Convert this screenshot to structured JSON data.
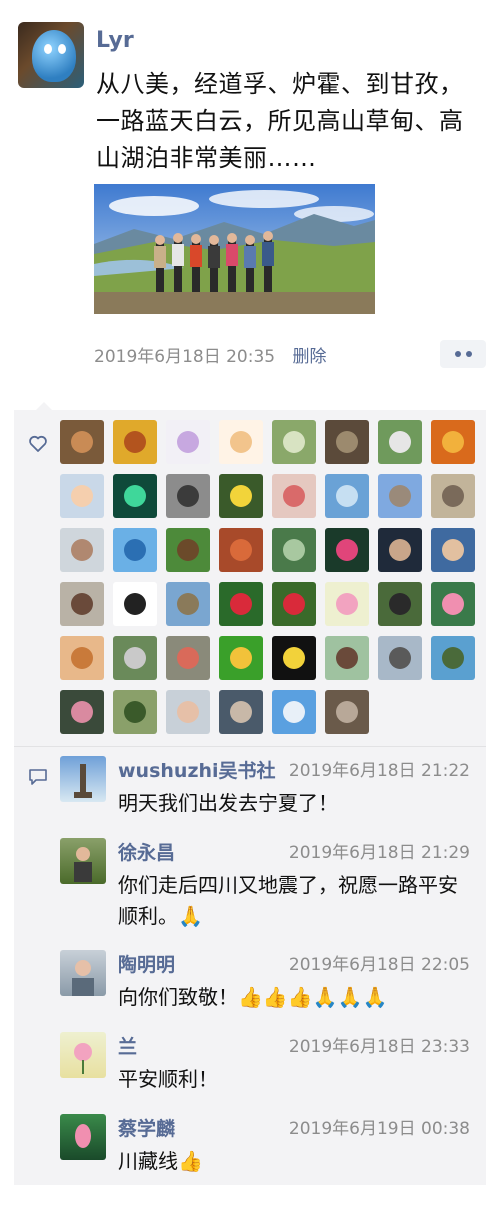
{
  "post": {
    "author": "Lyr",
    "text": "从八美，经道孚、炉霍、到甘孜，一路蓝天白云，所见高山草甸、高山湖泊非常美丽……",
    "timestamp": "2019年6月18日 20:35",
    "delete_label": "删除"
  },
  "likes": {
    "tiles": [
      {
        "bg": "#7a5a3a",
        "fg": "#c98b55"
      },
      {
        "bg": "#e0a92b",
        "fg": "#b3541e"
      },
      {
        "bg": "#f2f0f6",
        "fg": "#c7a8e0"
      },
      {
        "bg": "#fff3e6",
        "fg": "#f2c48c"
      },
      {
        "bg": "#8aa86a",
        "fg": "#d8e3c2"
      },
      {
        "bg": "#5b4a3a",
        "fg": "#9c8a6e"
      },
      {
        "bg": "#6f9a5c",
        "fg": "#e6e6e6"
      },
      {
        "bg": "#d96a1c",
        "fg": "#f2b13c"
      },
      {
        "bg": "#c9d8e8",
        "fg": "#f5cfae"
      },
      {
        "bg": "#0f4a3a",
        "fg": "#3fd79a"
      },
      {
        "bg": "#8c8c8c",
        "fg": "#3b3b3b"
      },
      {
        "bg": "#3a5a2a",
        "fg": "#f2d43a"
      },
      {
        "bg": "#e5c8c0",
        "fg": "#d96a6a"
      },
      {
        "bg": "#6aa2d6",
        "fg": "#c6dff2"
      },
      {
        "bg": "#7fa9e0",
        "fg": "#9a8a7a"
      },
      {
        "bg": "#c2b49a",
        "fg": "#7a6a5a"
      },
      {
        "bg": "#cfd6dc",
        "fg": "#b08870"
      },
      {
        "bg": "#6ab0e6",
        "fg": "#2b6fb3"
      },
      {
        "bg": "#4d8a3a",
        "fg": "#6b4a2a"
      },
      {
        "bg": "#a84a2a",
        "fg": "#d96a3a"
      },
      {
        "bg": "#4a7a4a",
        "fg": "#a8c8a0"
      },
      {
        "bg": "#1a3a2a",
        "fg": "#e0457a"
      },
      {
        "bg": "#1f2a3a",
        "fg": "#c9a68a"
      },
      {
        "bg": "#3f6aa0",
        "fg": "#e2c0a0"
      },
      {
        "bg": "#b9b2a6",
        "fg": "#6a4a3a"
      },
      {
        "bg": "#ffffff",
        "fg": "#222222"
      },
      {
        "bg": "#7aa6d0",
        "fg": "#8a7a5a"
      },
      {
        "bg": "#2a6a2a",
        "fg": "#d92a3a"
      },
      {
        "bg": "#3a6a2a",
        "fg": "#d92a3a"
      },
      {
        "bg": "#eef0d0",
        "fg": "#f2a3c0"
      },
      {
        "bg": "#4a6a3a",
        "fg": "#2a2a2a"
      },
      {
        "bg": "#3a7a4a",
        "fg": "#f08fb0"
      },
      {
        "bg": "#e8b88a",
        "fg": "#c97a3a"
      },
      {
        "bg": "#6a8a5a",
        "fg": "#c9c9c9"
      },
      {
        "bg": "#8a8a7a",
        "fg": "#d96a5a"
      },
      {
        "bg": "#3aa02a",
        "fg": "#f2c23a"
      },
      {
        "bg": "#111111",
        "fg": "#f2d23a"
      },
      {
        "bg": "#9fc2a0",
        "fg": "#6a4a3a"
      },
      {
        "bg": "#a8b8c8",
        "fg": "#5a5a5a"
      },
      {
        "bg": "#5aa0d0",
        "fg": "#4a6a3a"
      },
      {
        "bg": "#3a4a3a",
        "fg": "#d98aa0"
      },
      {
        "bg": "#8aa06a",
        "fg": "#3a5a2a"
      },
      {
        "bg": "#c8d0d8",
        "fg": "#e6c0a8"
      },
      {
        "bg": "#4a5a6a",
        "fg": "#c8b8a8"
      },
      {
        "bg": "#5aa0e0",
        "fg": "#e8f0f8"
      },
      {
        "bg": "#6a5a4a",
        "fg": "#b8a898"
      }
    ]
  },
  "comments": [
    {
      "name": "wushuzhi吴书社",
      "time": "2019年6月18日 21:22",
      "text": "明天我们出发去宁夏了！",
      "avatar": "#6fa0d8"
    },
    {
      "name": "徐永昌",
      "time": "2019年6月18日 21:29",
      "text": "你们走后四川又地震了，祝愿一路平安顺利。🙏",
      "avatar": "#5a7a3a"
    },
    {
      "name": "陶明明",
      "time": "2019年6月18日 22:05",
      "text": "向你们致敬！👍👍👍🙏🙏🙏",
      "avatar": "#8a9aa8"
    },
    {
      "name": "兰",
      "time": "2019年6月18日 23:33",
      "text": "平安顺利！",
      "avatar": "#e8e0a0"
    },
    {
      "name": "蔡学麟",
      "time": "2019年6月19日 00:38",
      "text": "川藏线👍",
      "avatar": "#2a6a3a"
    }
  ],
  "colors": {
    "link": "#576b95",
    "muted": "#8c8c8c",
    "panel": "#f3f3f5"
  },
  "icons": {
    "like": "heart-outline-icon",
    "comment": "comment-bubble-icon",
    "more": "more-dots-icon"
  }
}
